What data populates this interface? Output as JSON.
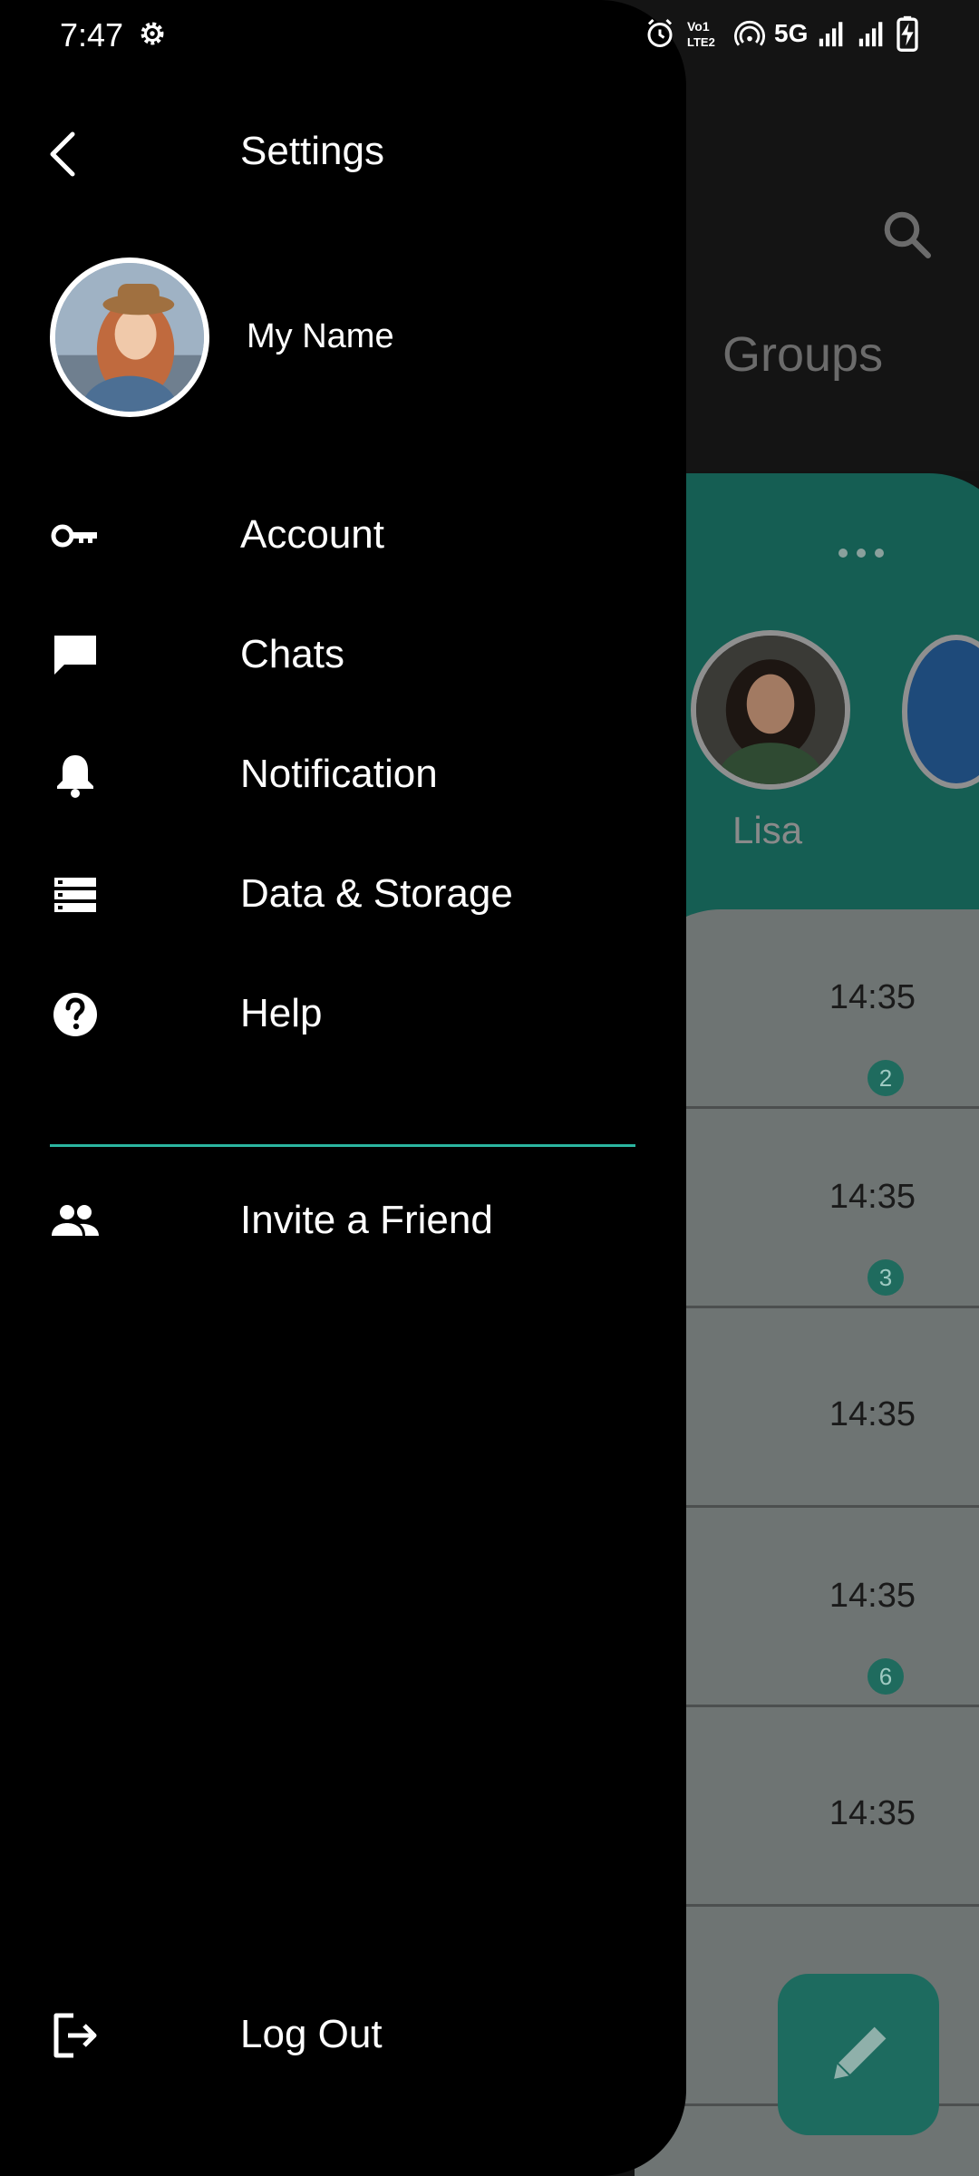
{
  "status_bar": {
    "time": "7:47",
    "network": "5G",
    "icons": [
      "gear-icon",
      "alarm-icon",
      "volte-icon",
      "hotspot-icon",
      "signal-icon",
      "signal-icon",
      "battery-charging-icon"
    ]
  },
  "background": {
    "tab_label": "Groups",
    "story_name": "Lisa",
    "chat_times": [
      "14:35",
      "14:35",
      "14:35",
      "14:35",
      "14:35"
    ],
    "unread_badges": [
      "2",
      "3",
      "",
      "6",
      ""
    ],
    "accent": "#155e53"
  },
  "drawer": {
    "title": "Settings",
    "profile_name": "My Name",
    "menu": [
      {
        "label": "Account",
        "icon": "key-icon"
      },
      {
        "label": "Chats",
        "icon": "chat-icon"
      },
      {
        "label": "Notification",
        "icon": "bell-icon"
      },
      {
        "label": "Data & Storage",
        "icon": "storage-icon"
      },
      {
        "label": "Help",
        "icon": "help-icon"
      }
    ],
    "invite": {
      "label": "Invite a Friend",
      "icon": "people-icon"
    },
    "logout": {
      "label": "Log Out",
      "icon": "logout-icon"
    },
    "divider_color": "#2bb5a0"
  }
}
